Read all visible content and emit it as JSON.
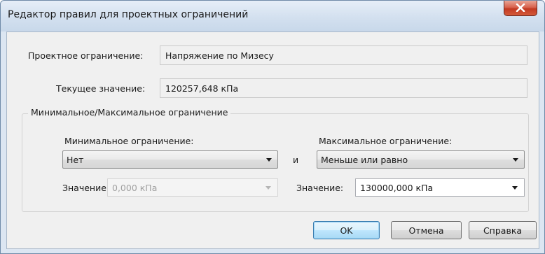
{
  "window": {
    "title": "Редактор правил для проектных ограничений"
  },
  "fields": {
    "constraint_label": "Проектное ограничение:",
    "constraint_value": "Напряжение по Мизесу",
    "current_label": "Текущее значение:",
    "current_value": "120257,648 кПа"
  },
  "group": {
    "title": "Минимальное/Максимальное ограничение",
    "min_label": "Минимальное ограничение:",
    "min_selected": "Нет",
    "connector": "и",
    "max_label": "Максимальное ограничение:",
    "max_selected": "Меньше или равно",
    "min_value_label": "Значение:",
    "min_value": "0,000 кПа",
    "max_value_label": "Значение:",
    "max_value": "130000,000 кПа"
  },
  "buttons": {
    "ok": "OK",
    "cancel": "Отмена",
    "help": "Справка"
  },
  "icons": {
    "close": "close-icon",
    "dropdown": "chevron-down-icon"
  }
}
